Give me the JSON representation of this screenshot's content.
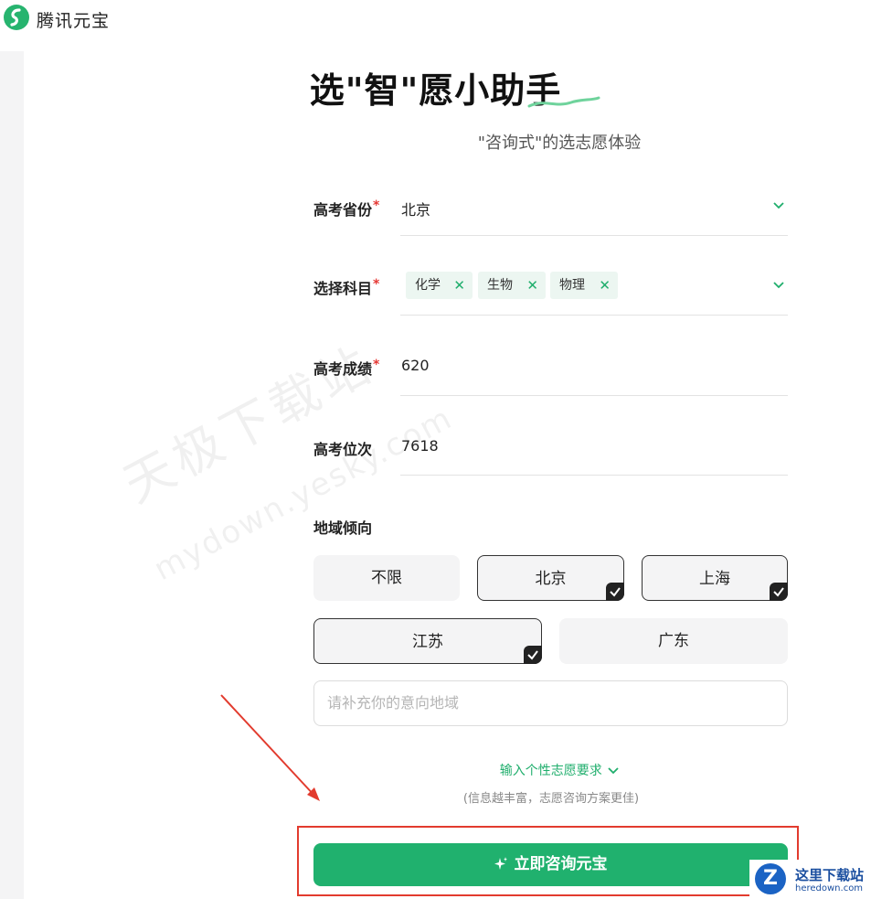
{
  "app": {
    "name": "腾讯元宝"
  },
  "page": {
    "title": "选\"智\"愿小助手",
    "subtitle": "\"咨询式\"的选志愿体验"
  },
  "form": {
    "province": {
      "label": "高考省份",
      "required_mark": "*",
      "value": "北京"
    },
    "subjects": {
      "label": "选择科目",
      "required_mark": "*",
      "tags": [
        "化学",
        "生物",
        "物理"
      ],
      "remove_symbol": "✕"
    },
    "score": {
      "label": "高考成绩",
      "required_mark": "*",
      "value": "620"
    },
    "rank": {
      "label": "高考位次",
      "value": "7618"
    },
    "region": {
      "label": "地域倾向",
      "options": [
        {
          "label": "不限",
          "selected": false
        },
        {
          "label": "北京",
          "selected": true
        },
        {
          "label": "上海",
          "selected": true
        },
        {
          "label": "江苏",
          "selected": true
        },
        {
          "label": "广东",
          "selected": false
        }
      ],
      "input_placeholder": "请补充你的意向地域"
    },
    "more_toggle": "输入个性志愿要求",
    "more_hint": "(信息越丰富，志愿咨询方案更佳)",
    "submit_label": "立即咨询元宝"
  },
  "watermarks": {
    "yesky_cn": "天极下载站",
    "yesky_url": "mydown.yesky.com",
    "corner_title": "这里下载站",
    "corner_url": "heredown.com",
    "corner_badge": "Z"
  },
  "colors": {
    "accent": "#20b16e",
    "required": "#e53935",
    "highlight_box": "#e23b2e"
  }
}
